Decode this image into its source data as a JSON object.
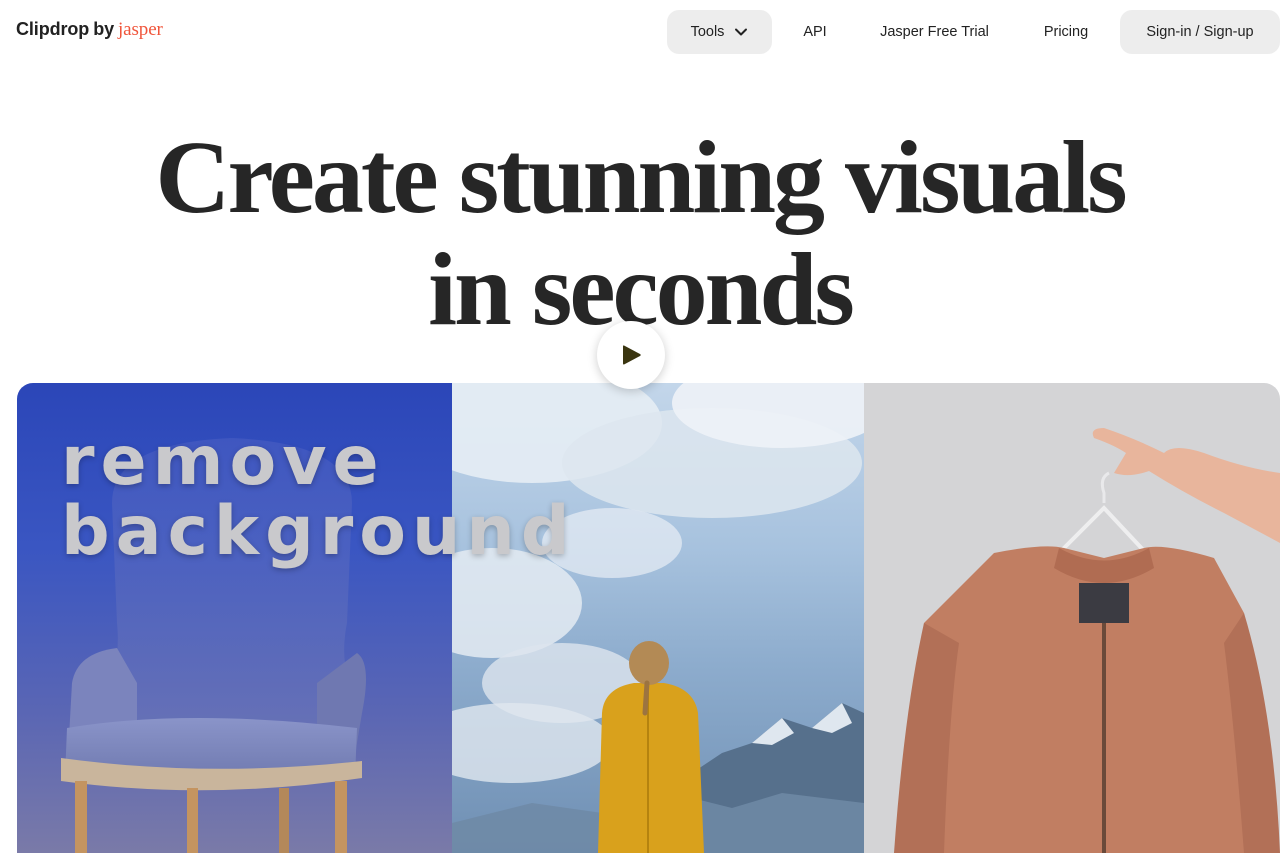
{
  "header": {
    "logo_main": "Clipdrop",
    "logo_by": "by",
    "logo_brand": "jasper",
    "nav": {
      "tools": "Tools",
      "api": "API",
      "trial": "Jasper Free Trial",
      "pricing": "Pricing",
      "signin": "Sign-in / Sign-up"
    }
  },
  "hero": {
    "headline_line1": "Create stunning visuals",
    "headline_line2": "in seconds",
    "overlay_line1": "remove",
    "overlay_line2": "background"
  },
  "icons": {
    "tools_chevron": "chevron-down-icon",
    "play": "play-icon"
  },
  "colors": {
    "brand_accent": "#f0553b",
    "pill_bg": "#ededed",
    "headline": "#262626",
    "play_triangle": "#3a3510"
  }
}
